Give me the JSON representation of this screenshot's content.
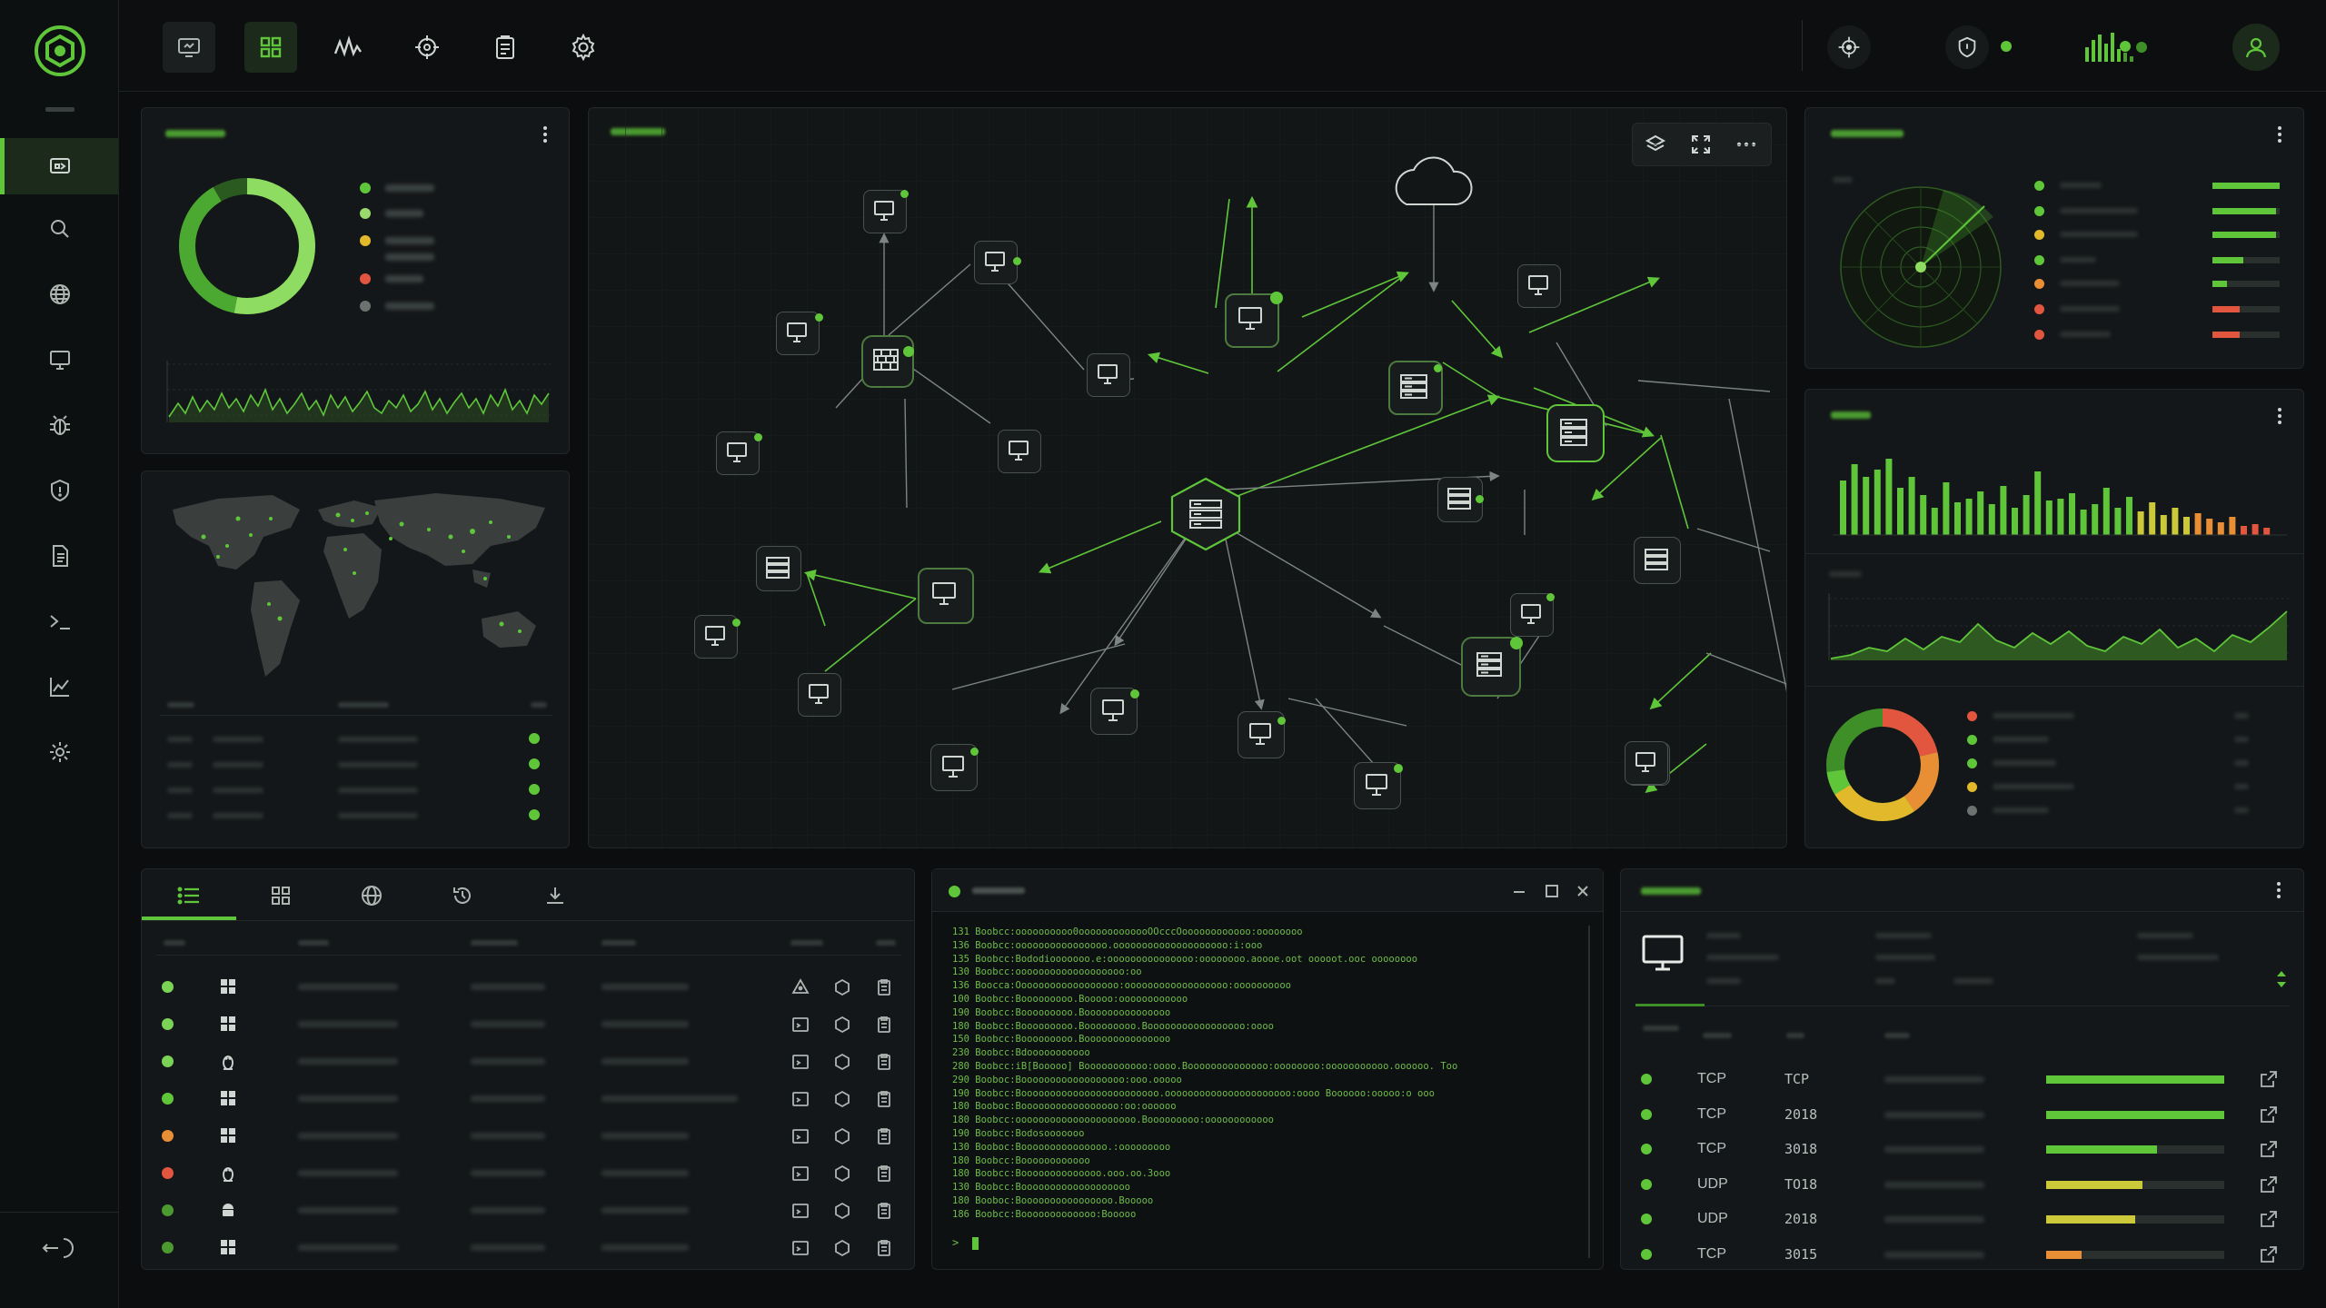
{
  "colors": {
    "bg": "#0b0d0e",
    "panel": "#141719",
    "accent": "#5fc63a",
    "accent_dark": "#3e8f28",
    "yellow": "#e2b92a",
    "orange": "#e88f35",
    "red": "#e2553f",
    "gray": "#6b7270"
  },
  "sidebar": {
    "logo": "hexagon-logo-icon",
    "items": [
      {
        "icon": "dashboard-icon",
        "active": true
      },
      {
        "icon": "search-icon"
      },
      {
        "icon": "globe-icon"
      },
      {
        "icon": "monitor-icon"
      },
      {
        "icon": "bug-icon"
      },
      {
        "icon": "shield-icon"
      },
      {
        "icon": "document-icon"
      },
      {
        "icon": "terminal-icon"
      },
      {
        "icon": "chart-icon"
      },
      {
        "icon": "settings-icon"
      }
    ],
    "footer_icon": "logout-icon"
  },
  "topbar": {
    "tools": [
      "monitor-icon",
      "grid-icon",
      "activity-icon",
      "target-icon",
      "clipboard-icon",
      "settings-icon"
    ],
    "status": [
      "target-icon",
      "shield-icon",
      "signal-bars-icon",
      "user-icon"
    ]
  },
  "map_toolbar": [
    "layers-icon",
    "fullscreen-icon",
    "more-icon"
  ],
  "connections": {
    "rows": [
      {
        "status": "#5fc63a",
        "protocol": "TCP",
        "port": "TCP",
        "fill": 1.0,
        "bar": "#5fc63a"
      },
      {
        "status": "#5fc63a",
        "protocol": "TCP",
        "port": "2018",
        "fill": 1.0,
        "bar": "#5fc63a"
      },
      {
        "status": "#5fc63a",
        "protocol": "TCP",
        "port": "3018",
        "fill": 0.62,
        "bar": "#5fc63a"
      },
      {
        "status": "#5fc63a",
        "protocol": "UDP",
        "port": "TO18",
        "fill": 0.54,
        "bar": "#cbc93a"
      },
      {
        "status": "#5fc63a",
        "protocol": "UDP",
        "port": "2018",
        "fill": 0.5,
        "bar": "#cbc93a"
      },
      {
        "status": "#5fc63a",
        "protocol": "TCP",
        "port": "3015",
        "fill": 0.2,
        "bar": "#e88f35"
      }
    ]
  },
  "hosts": {
    "tabs": [
      "list-icon",
      "grid-icon",
      "globe-icon",
      "history-icon",
      "download-icon"
    ],
    "rows": [
      {
        "status": "#7bd356",
        "os": "windows-icon"
      },
      {
        "status": "#7bd356",
        "os": "windows-icon"
      },
      {
        "status": "#7bd356",
        "os": "linux-icon"
      },
      {
        "status": "#5fc63a",
        "os": "windows-icon"
      },
      {
        "status": "#e88f35",
        "os": "windows-icon"
      },
      {
        "status": "#e2553f",
        "os": "linux-icon"
      },
      {
        "status": "#4a9a30",
        "os": "android-icon"
      },
      {
        "status": "#4a9a30",
        "os": "windows-icon"
      }
    ]
  },
  "terminal": {
    "lines": [
      "131 Boobcc:oooooooooo0ooooooooooooOOcccOoooooooooooo:oooooooo",
      "136 Boobcc:oooooooooooooooo.oooooooooooooooooooo:i:ooo",
      "135 Boobcc:Bododiooooooo.e:ooooooooooooooo:oooooooo.aoooe.oot ooooot.ooc oooooooo",
      "130 Boobcc:ooooooooooooooooooo:oo",
      "136 Boocca:Oooooooooooooooooo:oooooooooooooooooo:oooooooooo",
      "100 Boobcc:Booooooooo.Booooo:oooooooooooo",
      "190 Boobcc:Booooooooo.Booooooooooooooo",
      "180 Boobcc:Booooooooo.Booooooooo.Booooooooooooooooo:oooo",
      "150 Boobcc:Booooooooo.Booooooooooooooo",
      "230 Boobcc:Bdooooooooooo",
      "280 Boobcc:iB[Booooo] Booooooooooo:oooo.Boooooooooooooo:oooooooo:ooooooooooo.oooooo. Too",
      "290 Booboc:Boooooooooooooooooo:ooo.ooooo",
      "190 Boobcc:Boooooooooooooooooooooooo.oooooooooooooooooooooo:oooo Boooooo:ooooo:o ooo",
      "180 Booboc:Booooooooooooooooo:oo:oooooo",
      "180 Boobcc:ooooooooooooooooooooo.Booooooooo:oooooooooooo",
      "190 Boobcc:Bodosooooooo",
      "130 Booboc:Booooooooooooooo.:ooooooooo",
      "180 Boobcc:Boooooooooooo",
      "180 Boobcc:Boooooooooooooo.ooo.oo.3ooo",
      "130 Boobcc:Booooooooooooooooooo",
      "180 Booboc:Boooooooooooooooo.Booooo",
      "186 Boobcc:Booooooooooooo:Booooo"
    ],
    "prompt": ">"
  },
  "world_nodes_note": "",
  "bar_series_note": ""
}
